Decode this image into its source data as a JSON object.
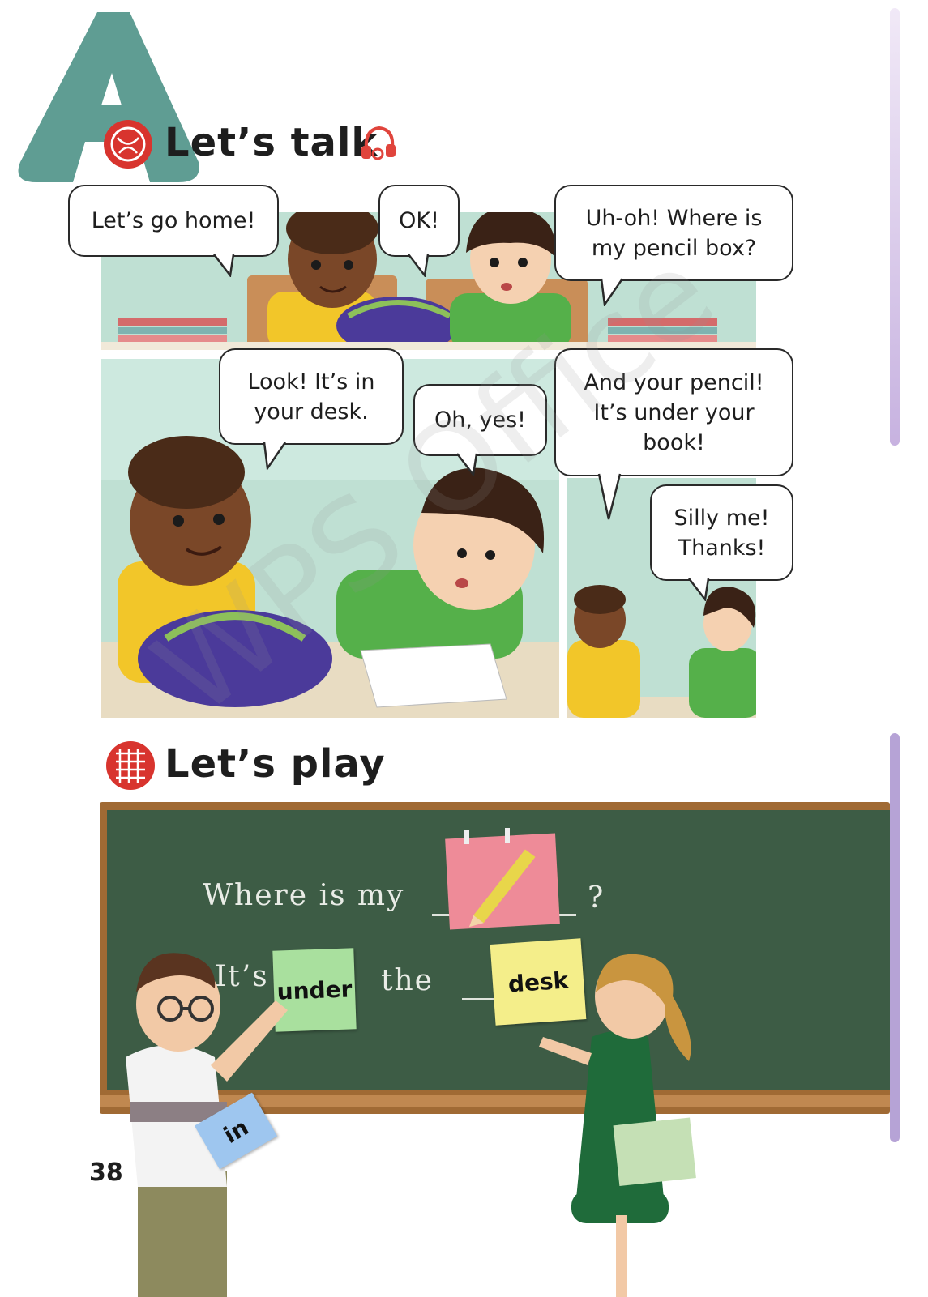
{
  "section_letter": "A",
  "talk": {
    "title": "Let’s talk"
  },
  "play": {
    "title": "Let’s play"
  },
  "bubbles": {
    "b1": "Let’s go home!",
    "b2": "OK!",
    "b3": "Uh-oh! Where is my pencil box?",
    "b4": "Look! It’s in your desk.",
    "b5": "Oh, yes!",
    "b6": "And your pencil! It’s under your book!",
    "b7": "Silly me! Thanks!"
  },
  "blackboard": {
    "line1": "Where  is  my",
    "qmark": "?",
    "its": "It’s",
    "the": "the",
    "card_under": "under",
    "card_desk": "desk",
    "card_in": "in"
  },
  "page_number": "38",
  "watermark": "WPS Office",
  "colors": {
    "letter_teal": "#5f9d93",
    "sidebar_purple": "#b8a2d6",
    "board_green": "#3d5c45",
    "board_frame": "#a06a34",
    "classroom_wall": "#bfe0d3"
  }
}
